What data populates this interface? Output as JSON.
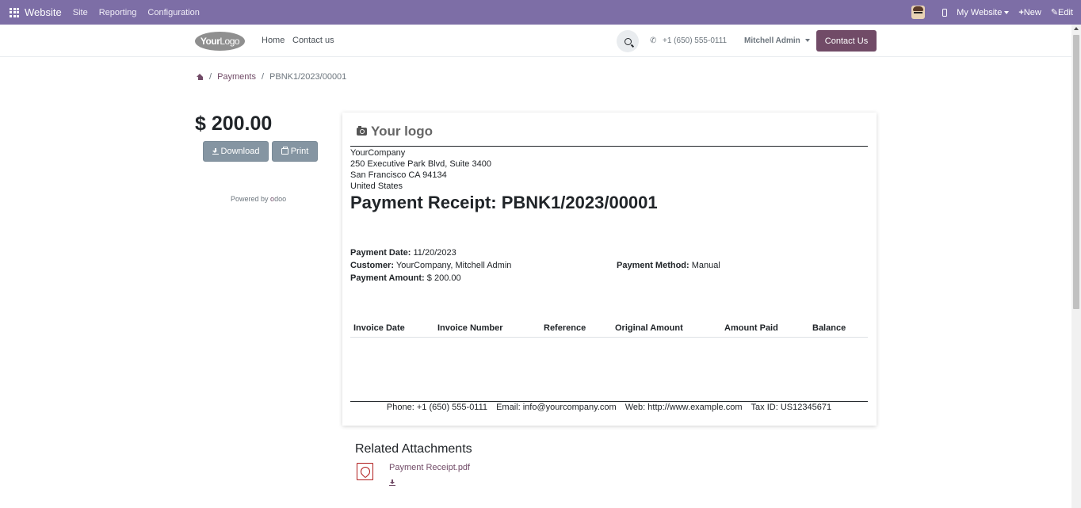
{
  "admin_bar": {
    "brand": "Website",
    "menus": [
      "Site",
      "Reporting",
      "Configuration"
    ],
    "website_selector": "My Website",
    "new_label": "New",
    "edit_label": "Edit"
  },
  "header": {
    "logo_text_bold": "Your",
    "logo_text_light": "Logo",
    "nav": [
      "Home",
      "Contact us"
    ],
    "phone": "+1 (650) 555-0111",
    "user": "Mitchell Admin",
    "cta": "Contact Us"
  },
  "breadcrumb": {
    "items": [
      "Payments",
      "PBNK1/2023/00001"
    ]
  },
  "sidebar": {
    "amount": "$ 200.00",
    "download_label": "Download",
    "print_label": "Print",
    "powered_by": "Powered by",
    "odoo_o": "o",
    "odoo_rest": "doo"
  },
  "document": {
    "logo_text": "Your logo",
    "company": {
      "name": "YourCompany",
      "street": "250 Executive Park Blvd, Suite 3400",
      "city": "San Francisco CA 94134",
      "country": "United States"
    },
    "title": "Payment Receipt: PBNK1/2023/00001",
    "payment_date_label": "Payment Date:",
    "payment_date": "11/20/2023",
    "customer_label": "Customer:",
    "customer": "YourCompany, Mitchell Admin",
    "payment_method_label": "Payment Method:",
    "payment_method": "Manual",
    "payment_amount_label": "Payment Amount:",
    "payment_amount": "$ 200.00",
    "table_headers": [
      "Invoice Date",
      "Invoice Number",
      "Reference",
      "Original Amount",
      "Amount Paid",
      "Balance"
    ],
    "footer": {
      "phone": "Phone: +1 (650) 555-0111",
      "email": "Email: info@yourcompany.com",
      "web": "Web: http://www.example.com",
      "tax": "Tax ID: US12345671"
    }
  },
  "attachments": {
    "title": "Related Attachments",
    "file_name": "Payment Receipt.pdf"
  },
  "colors": {
    "admin_bar": "#7d6ea6",
    "brand_primary": "#714b67",
    "secondary_button": "#8595a2"
  }
}
